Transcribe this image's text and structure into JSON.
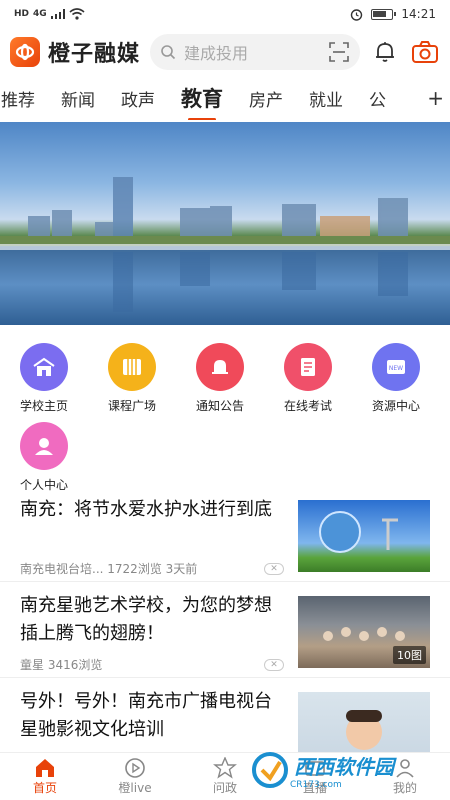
{
  "status": {
    "net": "HD",
    "signal": "4G",
    "time": "14:21"
  },
  "header": {
    "app_name": "橙子融媒",
    "search_placeholder": "建成投用"
  },
  "tabs": [
    {
      "label": "推荐"
    },
    {
      "label": "新闻"
    },
    {
      "label": "政声"
    },
    {
      "label": "教育"
    },
    {
      "label": "房产"
    },
    {
      "label": "就业"
    },
    {
      "label": "公"
    }
  ],
  "active_tab": "教育",
  "tab_more": "+",
  "grid": [
    {
      "label": "学校主页",
      "color": "#7b6df0",
      "icon": "school-icon"
    },
    {
      "label": "课程广场",
      "color": "#f5b21a",
      "icon": "course-icon"
    },
    {
      "label": "通知公告",
      "color": "#f04a5a",
      "icon": "bell-icon"
    },
    {
      "label": "在线考试",
      "color": "#f0506a",
      "icon": "exam-icon"
    },
    {
      "label": "资源中心",
      "color": "#6f73f0",
      "icon": "resource-icon"
    },
    {
      "label": "个人中心",
      "color": "#f06bc0",
      "icon": "person-icon"
    }
  ],
  "news": [
    {
      "title": "南充：将节水爱水护水进行到底",
      "source": "南充电视台培...",
      "views": "1722浏览",
      "time": "3天前"
    },
    {
      "title": "南充星驰艺术学校，为您的梦想插上腾飞的翅膀！",
      "source": "童星",
      "views": "3416浏览",
      "time": "",
      "badge": "10图"
    },
    {
      "title": "号外！号外！南充市广播电视台星驰影视文化培训",
      "source": "",
      "views": "",
      "time": ""
    }
  ],
  "bottom_nav": [
    {
      "label": "首页"
    },
    {
      "label": "橙live"
    },
    {
      "label": "问政"
    },
    {
      "label": "直播"
    },
    {
      "label": "我的"
    }
  ],
  "watermark": {
    "text": "西西软件园",
    "sub": "CR173.com"
  },
  "colors": {
    "accent": "#e8420a"
  }
}
